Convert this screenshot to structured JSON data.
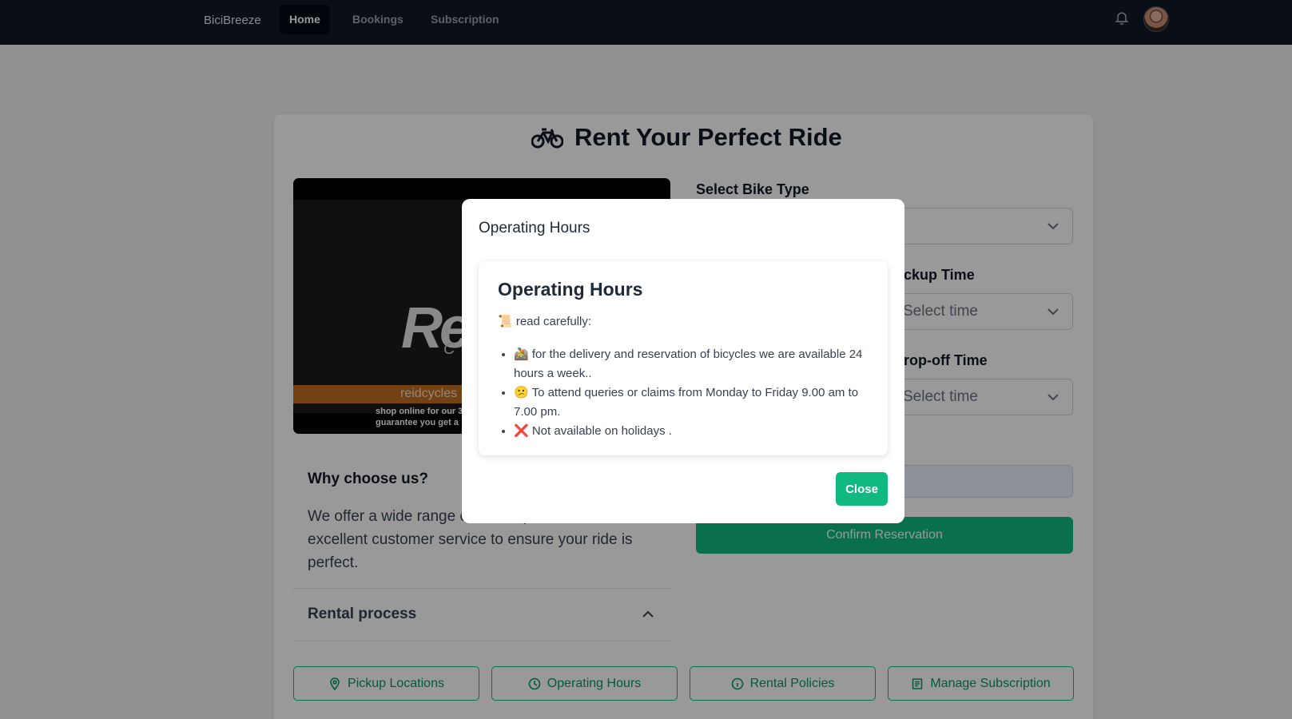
{
  "nav": {
    "brand": "BiciBreeze",
    "links": [
      {
        "label": "Home"
      },
      {
        "label": "Bookings"
      },
      {
        "label": "Subscription"
      }
    ]
  },
  "page": {
    "title": "Rent Your Perfect Ride",
    "title_icon": "bicycle-icon"
  },
  "video": {
    "logo_text": "Re",
    "logo_sub": "C",
    "strip_text": "reidcycles",
    "promo_line1": "shop online for our 3",
    "promo_line2": "guarantee you get a"
  },
  "why": {
    "heading": "Why choose us?",
    "body": "We offer a wide range o                              rental options, and excellent customer service to ensure your ride is perfect."
  },
  "accordion": {
    "label": "Rental process"
  },
  "form": {
    "bike_type_label": "Select Bike Type",
    "bike_type_value": "",
    "pickup_label": "ckup Time",
    "pickup_value": "Select time",
    "dropoff_label": "rop-off Time",
    "dropoff_value": "Select time",
    "confirm_label": "Confirm Reservation"
  },
  "quick_actions": [
    {
      "label": "Pickup Locations",
      "icon": "map-pin-icon"
    },
    {
      "label": "Operating Hours",
      "icon": "clock-icon"
    },
    {
      "label": "Rental Policies",
      "icon": "info-icon"
    },
    {
      "label": "Manage Subscription",
      "icon": "list-icon"
    }
  ],
  "modal": {
    "title": "Operating Hours",
    "card_title": "Operating Hours",
    "note": "📜 read carefully:",
    "items": [
      "🚵 for the delivery and reservation of bicycles we are available 24 hours a week..",
      "😕 To attend queries or claims from Monday to Friday 9.00 am to 7.00 pm.",
      "❌ Not available on holidays ."
    ],
    "close_label": "Close"
  },
  "colors": {
    "nav_bg": "#111827",
    "accent": "#10b981",
    "overlay": "rgba(0,0,0,0.4)"
  }
}
